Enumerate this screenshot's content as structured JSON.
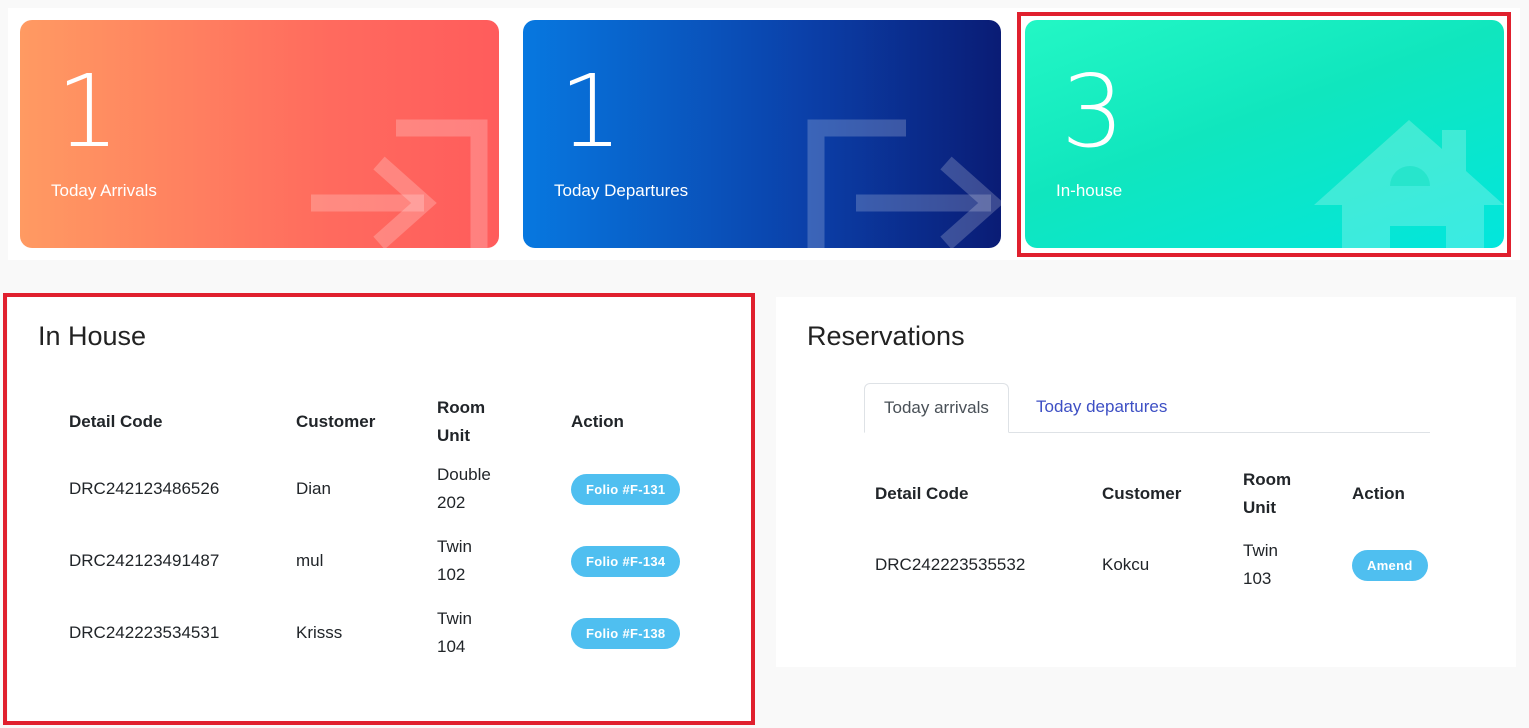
{
  "stats": {
    "arrivals": {
      "count": "1",
      "label": "Today Arrivals",
      "icon": "arrow-in-icon"
    },
    "departures": {
      "count": "1",
      "label": "Today Departures",
      "icon": "arrow-out-icon"
    },
    "inhouse": {
      "count": "3",
      "label": "In-house",
      "icon": "house-icon"
    }
  },
  "in_house": {
    "title": "In House",
    "headers": {
      "detail_code": "Detail Code",
      "customer": "Customer",
      "room_unit": [
        "Room",
        "Unit"
      ],
      "action": "Action"
    },
    "rows": [
      {
        "detail_code": "DRC242123486526",
        "customer": "Dian",
        "room": [
          "Double",
          "202"
        ],
        "action": "Folio #F-131"
      },
      {
        "detail_code": "DRC242123491487",
        "customer": "mul",
        "room": [
          "Twin",
          "102"
        ],
        "action": "Folio #F-134"
      },
      {
        "detail_code": "DRC242223534531",
        "customer": "Krisss",
        "room": [
          "Twin",
          "104"
        ],
        "action": "Folio #F-138"
      }
    ]
  },
  "reservations": {
    "title": "Reservations",
    "tabs": [
      {
        "label": "Today arrivals",
        "active": true
      },
      {
        "label": "Today departures",
        "active": false
      }
    ],
    "headers": {
      "detail_code": "Detail Code",
      "customer": "Customer",
      "room_unit": [
        "Room",
        "Unit"
      ],
      "action": "Action"
    },
    "rows": [
      {
        "detail_code": "DRC242223535532",
        "customer": "Kokcu",
        "room": [
          "Twin",
          "103"
        ],
        "action": "Amend"
      }
    ]
  },
  "colors": {
    "highlight": "#e0202e",
    "pill": "#4fbff0",
    "tab_link": "#3d4fc4"
  }
}
